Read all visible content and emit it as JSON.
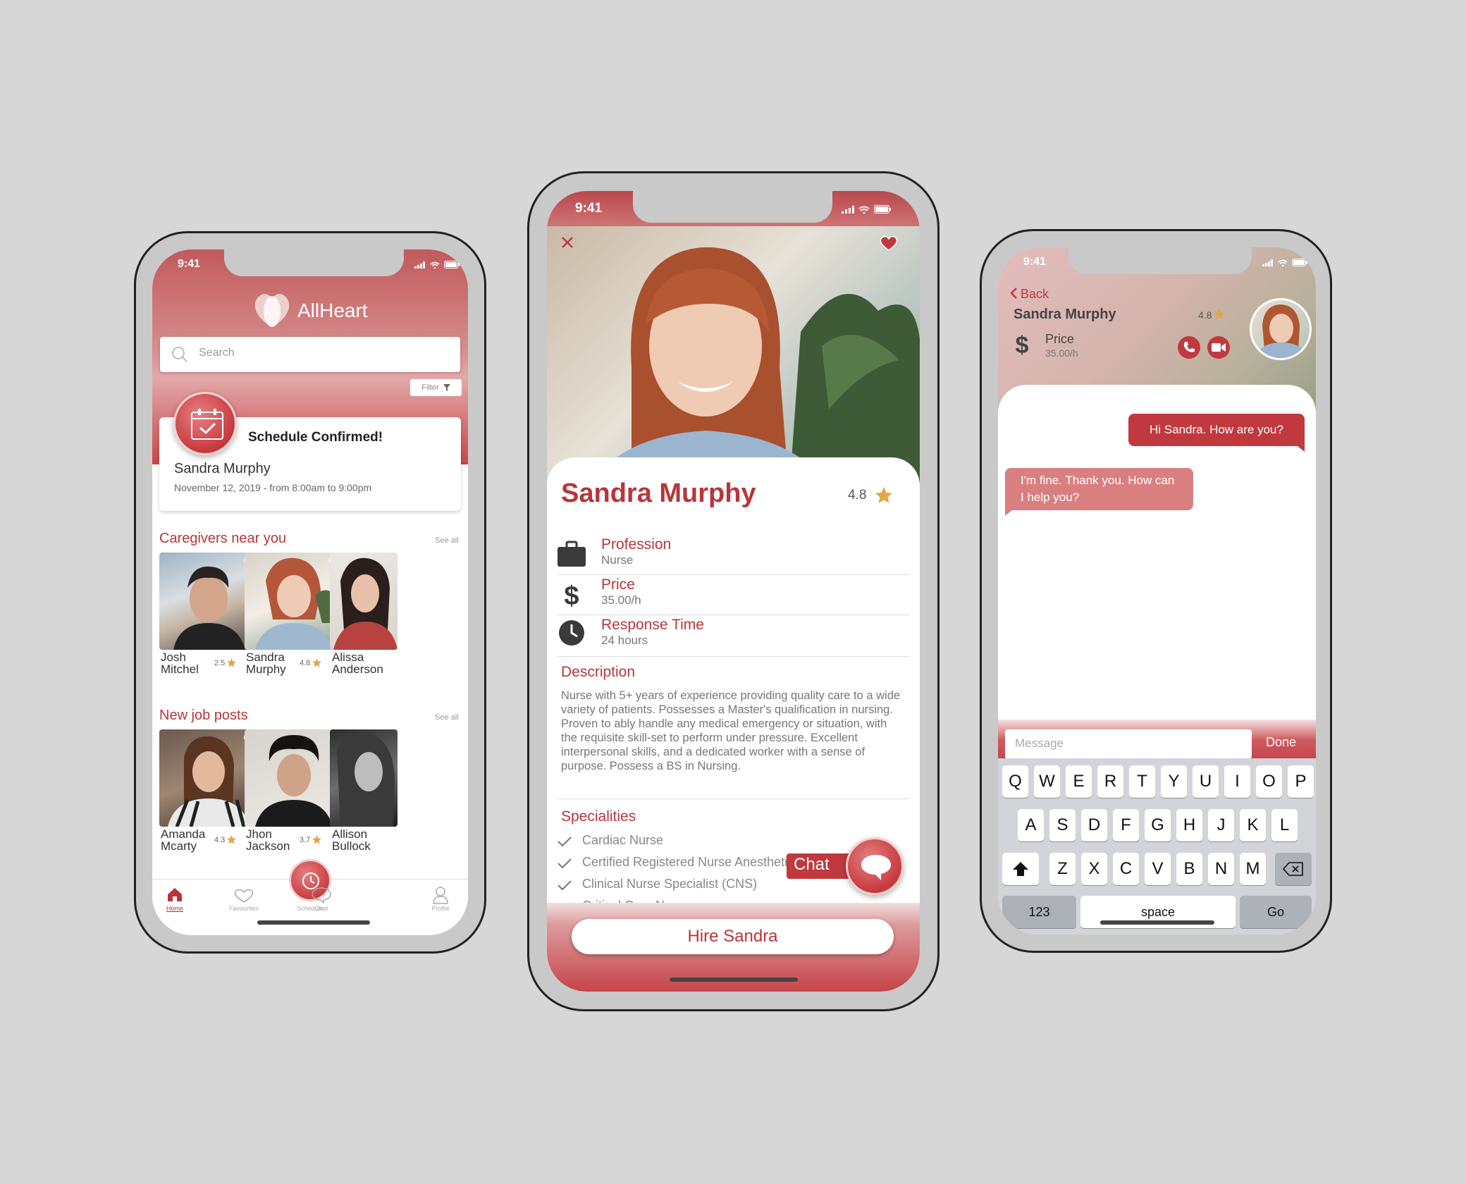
{
  "colors": {
    "accent": "#b8353a",
    "accent_light": "#d6898a",
    "background": "#d7d7d8",
    "star": "#e0a74b"
  },
  "status": {
    "time": "9:41"
  },
  "home": {
    "app_name": "AllHeart",
    "search_placeholder": "Search",
    "filter_label": "Filter",
    "schedule": {
      "title": "Schedule Confirmed!",
      "name": "Sandra Murphy",
      "detail": "November 12, 2019 - from 8:00am to 9:00pm"
    },
    "caregivers": {
      "title": "Caregivers near you",
      "see_all": "See all",
      "items": [
        {
          "first": "Josh",
          "last": "Mitchel",
          "rating": "2.5"
        },
        {
          "first": "Sandra",
          "last": "Murphy",
          "rating": "4.8"
        },
        {
          "first": "Alissa",
          "last": "Anderson",
          "rating": ""
        }
      ]
    },
    "jobs": {
      "title": "New job posts",
      "see_all": "See all",
      "items": [
        {
          "first": "Amanda",
          "last": "Mcarty",
          "rating": "4.3"
        },
        {
          "first": "Jhon",
          "last": "Jackson",
          "rating": "3.7"
        },
        {
          "first": "Allison",
          "last": "Bullock",
          "rating": ""
        }
      ]
    },
    "tabs": [
      "Home",
      "Favourites",
      "Schedule",
      "Chat",
      "Profile"
    ]
  },
  "profile": {
    "name": "Sandra Murphy",
    "rating": "4.8",
    "rows": [
      {
        "label": "Profession",
        "value": "Nurse",
        "icon": "briefcase-icon"
      },
      {
        "label": "Price",
        "value": "35.00/h",
        "icon": "dollar-icon"
      },
      {
        "label": "Response Time",
        "value": "24 hours",
        "icon": "clock-icon"
      }
    ],
    "description_title": "Description",
    "description": "Nurse with 5+ years of experience providing quality care to a wide variety of patients. Possesses a Master's qualification in nursing. Proven to ably handle any medical emergency or situation, with the requisite skill-set to perform under pressure. Excellent interpersonal skills, and a dedicated worker with a sense of purpose. Possess a BS in Nursing.",
    "specialities_title": "Specialities",
    "specialities": [
      "Cardiac Nurse",
      "Certified Registered Nurse Anesthetist",
      "Clinical Nurse Specialist (CNS)",
      "Critical Care Nurse"
    ],
    "chat_label": "Chat",
    "hire_label": "Hire Sandra"
  },
  "chat": {
    "back": "Back",
    "name": "Sandra Murphy",
    "rating": "4.8",
    "price_label": "Price",
    "price_value": "35.00/h",
    "messages": [
      {
        "from": "me",
        "text": "Hi Sandra. How are you?"
      },
      {
        "from": "them",
        "text": "I'm fine. Thank you. How can I help you?"
      }
    ],
    "message_placeholder": "Message",
    "done": "Done"
  },
  "keyboard": {
    "row1": [
      "Q",
      "W",
      "E",
      "R",
      "T",
      "Y",
      "U",
      "I",
      "O",
      "P"
    ],
    "row2": [
      "A",
      "S",
      "D",
      "F",
      "G",
      "H",
      "J",
      "K",
      "L"
    ],
    "row3": [
      "Z",
      "X",
      "C",
      "V",
      "B",
      "N",
      "M"
    ],
    "numbers": "123",
    "space": "space",
    "go": "Go"
  }
}
